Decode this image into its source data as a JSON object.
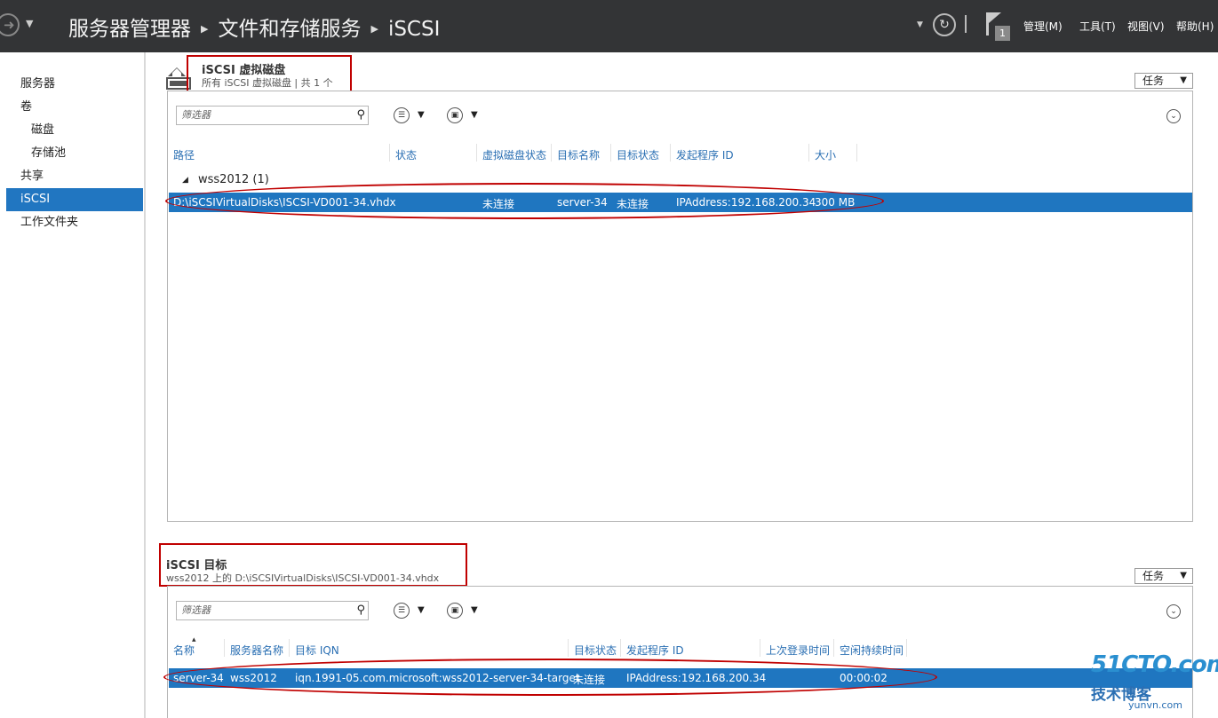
{
  "header": {
    "breadcrumb": [
      "服务器管理器",
      "文件和存储服务",
      "iSCSI"
    ],
    "notification_count": "1",
    "menus": [
      "管理(M)",
      "工具(T)",
      "视图(V)",
      "帮助(H)"
    ]
  },
  "sidebar": {
    "items": [
      "服务器",
      "卷",
      "磁盘",
      "存储池",
      "共享",
      "iSCSI",
      "工作文件夹"
    ],
    "active": "iSCSI"
  },
  "vdisk_tile": {
    "title": "iSCSI 虚拟磁盘",
    "subtitle": "所有 iSCSI 虚拟磁盘 | 共 1 个",
    "tasks_label": "任务",
    "filter_placeholder": "筛选器",
    "columns": [
      "路径",
      "状态",
      "虚拟磁盘状态",
      "目标名称",
      "目标状态",
      "发起程序 ID",
      "大小"
    ],
    "group_label": "wss2012 (1)",
    "rows": [
      {
        "path": "D:\\iSCSIVirtualDisks\\ISCSI-VD001-34.vhdx",
        "status": "",
        "vdisk_status": "未连接",
        "target_name": "server-34",
        "target_status": "未连接",
        "initiator_id": "IPAddress:192.168.200.34",
        "size": "300 MB"
      }
    ]
  },
  "target_tile": {
    "title": "iSCSI 目标",
    "subtitle": "wss2012 上的 D:\\iSCSIVirtualDisks\\ISCSI-VD001-34.vhdx",
    "tasks_label": "任务",
    "filter_placeholder": "筛选器",
    "columns": [
      "名称",
      "服务器名称",
      "目标 IQN",
      "目标状态",
      "发起程序 ID",
      "上次登录时间",
      "空闲持续时间"
    ],
    "rows": [
      {
        "name": "server-34",
        "server": "wss2012",
        "iqn": "iqn.1991-05.com.microsoft:wss2012-server-34-target",
        "status": "未连接",
        "initiator_id": "IPAddress:192.168.200.34",
        "last_login": "",
        "idle": "00:00:02"
      }
    ]
  },
  "watermark": {
    "line1": "51CTO.com",
    "line2": "技术博客",
    "line3": "yunvn.com"
  },
  "colors": {
    "header_bg": "#333436",
    "selection": "#1f76c0",
    "annotation": "#c00000",
    "column_header": "#2a6fb3"
  }
}
